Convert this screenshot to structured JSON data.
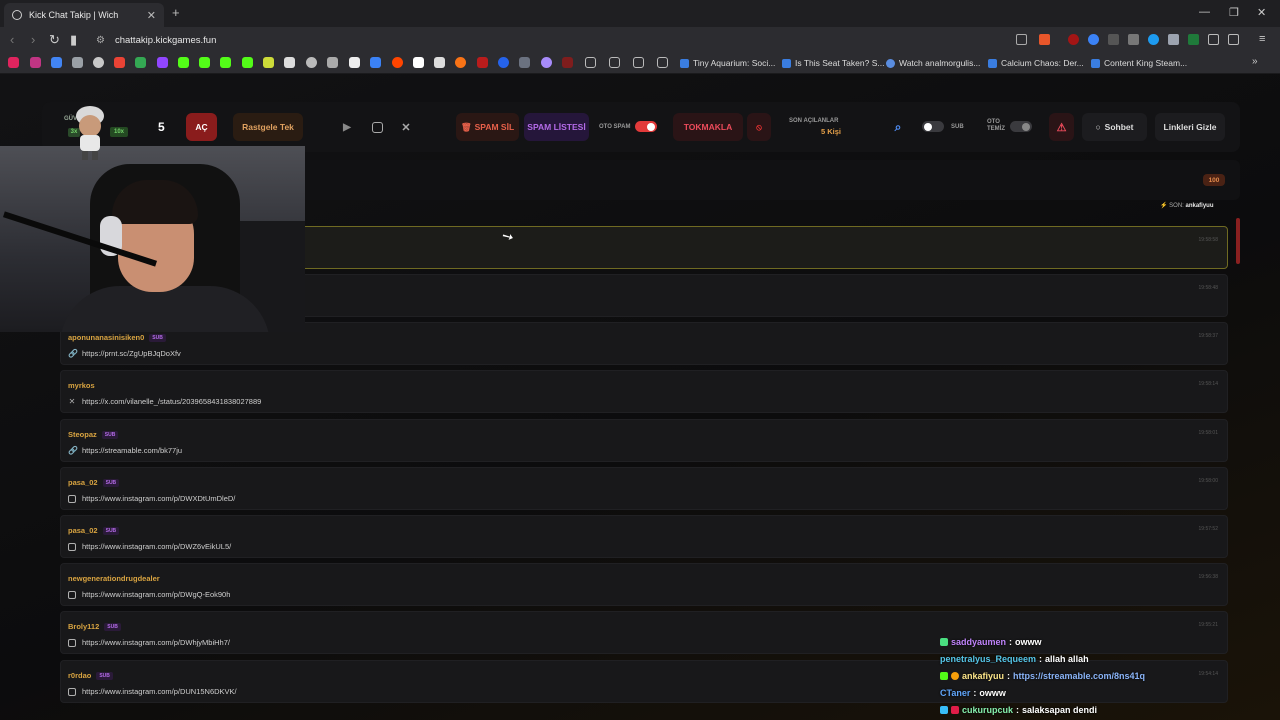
{
  "browser": {
    "tab_title": "Kick Chat Takip | Wich",
    "url": "chattakip.kickgames.fun",
    "bookmarks": [
      "Tiny Aquarium: Soci...",
      "Is This Seat Taken? S...",
      "Watch analmorgulis...",
      "Calcium Chaos: Der...",
      "Content King Steam..."
    ]
  },
  "toolbar": {
    "avatar_label": "GÜVE",
    "badge_3x": "3x",
    "badge_10x": "10x",
    "count": "5",
    "open_label": "AÇ",
    "random_label": "Rastgele Tek",
    "spam_delete_label": "SPAM SİL",
    "spam_list_label": "SPAM LİSTESİ",
    "auto_spam_label": "OTO SPAM",
    "hammer_label": "TOKMAKLA",
    "last_opened_label": "SON AÇILANLAR",
    "last_opened_count": "5 Kişi",
    "sub_label": "SUB",
    "auto_clean_label_1": "OTO",
    "auto_clean_label_2": "TEMİZ",
    "chat_label": "Sohbet",
    "hide_links_label": "Linkleri Gizle",
    "colors": {
      "accent_red": "#e23a3a",
      "purple": "#b46be8",
      "gold": "#d9a441"
    }
  },
  "panel": {
    "count_badge": "100",
    "last_prefix": "SON:",
    "last_user": "ankafiyuu"
  },
  "messages": [
    {
      "user": "",
      "sub": "",
      "link": "",
      "icon": "",
      "time": "19:58:58"
    },
    {
      "user": "",
      "sub": "",
      "link": "",
      "icon": "",
      "time": "19:58:48"
    },
    {
      "user": "aponunanasinisiken0",
      "sub": "SUB",
      "link": "https://prnt.sc/ZgUpBJqDoXfv",
      "icon": "link-icon",
      "time": "19:58:37"
    },
    {
      "user": "myrkos",
      "sub": "",
      "link": "https://x.com/vilanelle_/status/2039658431838027889",
      "icon": "x-icon",
      "time": "19:58:14"
    },
    {
      "user": "Steopaz",
      "sub": "SUB",
      "link": "https://streamable.com/bk77ju",
      "icon": "link-icon",
      "time": "19:58:01"
    },
    {
      "user": "pasa_02",
      "sub": "SUB",
      "link": "https://www.instagram.com/p/DWXDtUmDleD/",
      "icon": "instagram-icon",
      "time": "19:58:00"
    },
    {
      "user": "pasa_02",
      "sub": "SUB",
      "link": "https://www.instagram.com/p/DWZ6vEikUL5/",
      "icon": "instagram-icon",
      "time": "19:57:52"
    },
    {
      "user": "newgenerationdrugdealer",
      "sub": "",
      "link": "https://www.instagram.com/p/DWgQ-Eok90h",
      "icon": "instagram-icon",
      "time": "19:56:38"
    },
    {
      "user": "Broly112",
      "sub": "SUB",
      "link": "https://www.instagram.com/p/DWhjyMbiHh7/",
      "icon": "instagram-icon",
      "time": "19:55:21"
    },
    {
      "user": "r0rdao",
      "sub": "SUB",
      "link": "https://www.instagram.com/p/DUN15N6DKVK/",
      "icon": "instagram-icon",
      "time": "19:54:14"
    }
  ],
  "stream_chat": [
    {
      "user": "saddyaumen",
      "text": "owww"
    },
    {
      "user": "penetralyus_Requeem",
      "text": "allah allah"
    },
    {
      "user": "ankafiyuu",
      "text": "https://streamable.com/8ns41q"
    },
    {
      "user": "CTaner",
      "text": "owww"
    },
    {
      "user": "cukurupcuk",
      "text": "salaksapan dendi"
    }
  ]
}
